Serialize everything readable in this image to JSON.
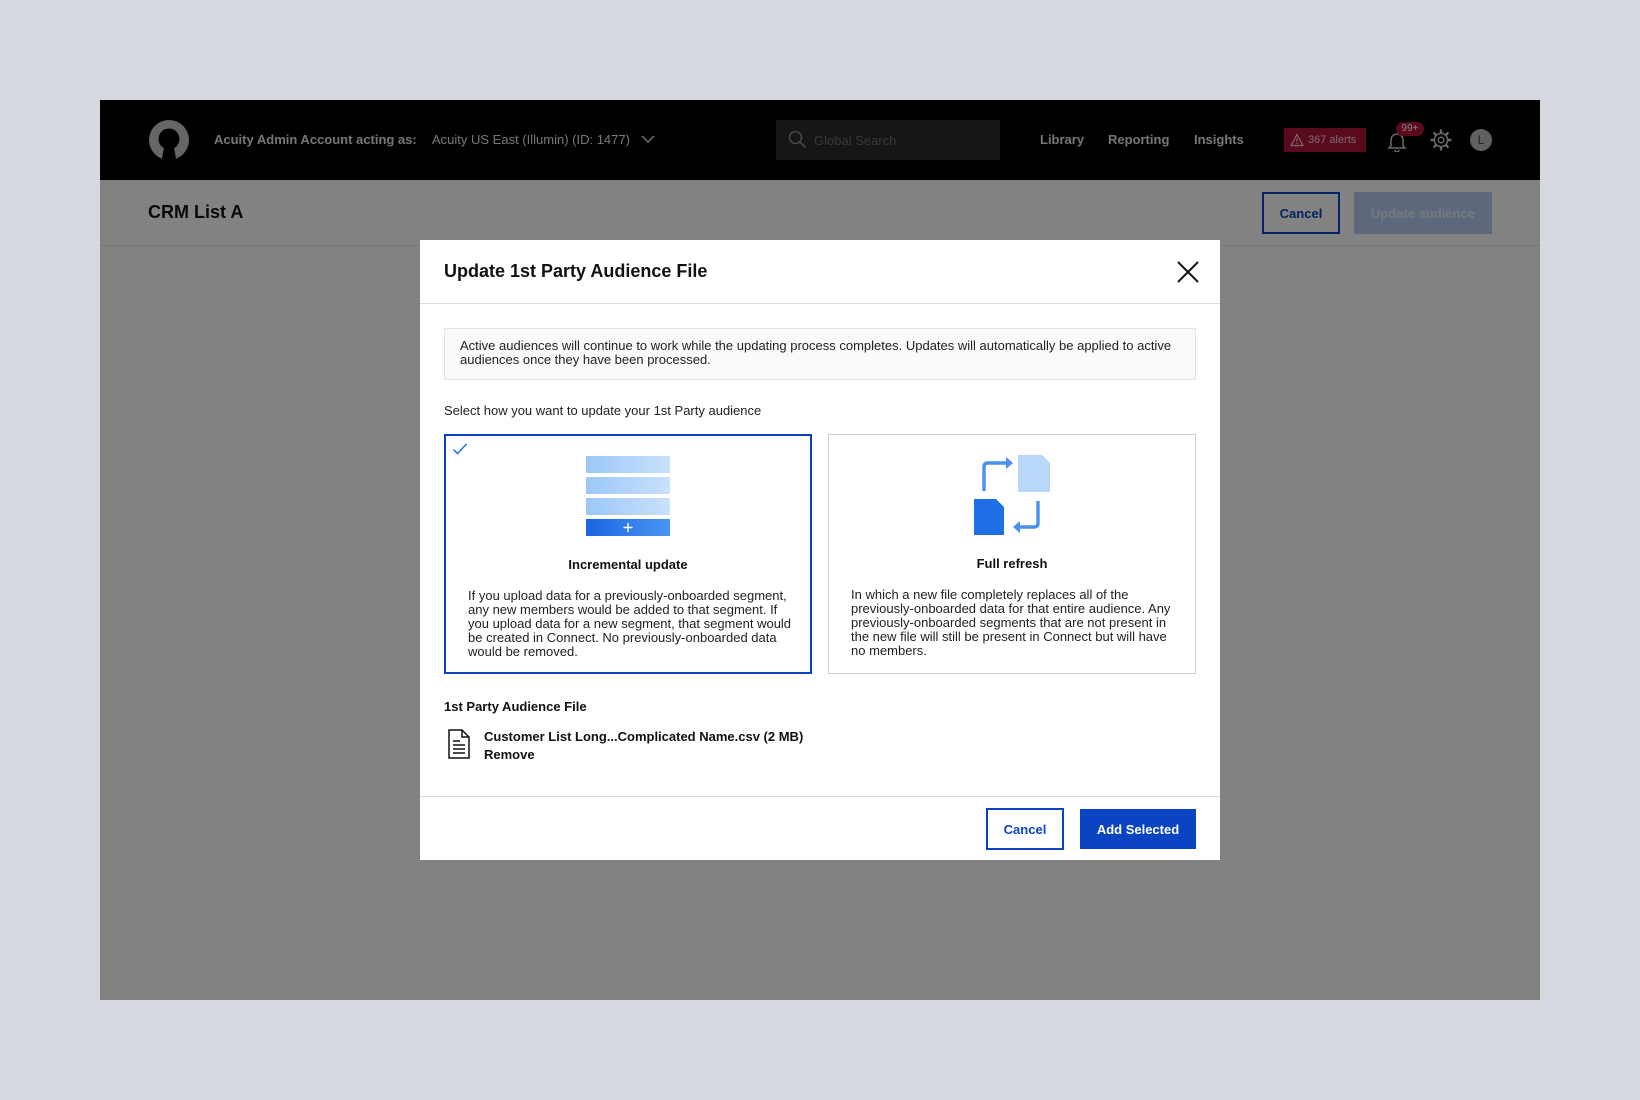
{
  "topnav": {
    "acting_label": "Acuity Admin Account acting as:",
    "account_name": "Acuity US East (Illumin) (ID: 1477)",
    "search_placeholder": "Global Search",
    "links": [
      "Library",
      "Reporting",
      "Insights"
    ],
    "alerts_label": "367 alerts",
    "notification_badge": "99+",
    "avatar_initial": "L"
  },
  "page": {
    "title": "CRM List A",
    "cancel_label": "Cancel",
    "update_label": "Update audience"
  },
  "modal": {
    "title": "Update 1st Party Audience File",
    "info": "Active audiences will continue to work while the updating process completes. Updates will automatically be applied to active audiences once they have been processed.",
    "select_label": "Select how you want to update your 1st Party audience",
    "options": [
      {
        "title": "Incremental update",
        "description": "If you upload data for a previously-onboarded segment, any new members would be added to that segment. If you upload data for a new segment, that segment would be created in Connect. No previously-onboarded data would be removed.",
        "selected": true,
        "icon": "stacked-rows-plus-icon"
      },
      {
        "title": "Full refresh",
        "description": "In which a new file completely replaces all of the previously-onboarded data for that entire audience. Any previously-onboarded segments that are not present in the new file will still be present in Connect but will have no members.",
        "selected": false,
        "icon": "refresh-files-icon"
      }
    ],
    "file_label": "1st Party Audience File",
    "file_name": "Customer List Long...Complicated Name.csv (2 MB)",
    "remove_label": "Remove",
    "cancel_label": "Cancel",
    "add_label": "Add Selected"
  },
  "colors": {
    "primary": "#0b44c2",
    "alert": "#b0143a",
    "illustration_light": "#b8d8fb",
    "illustration_dark": "#1f6fe6"
  }
}
